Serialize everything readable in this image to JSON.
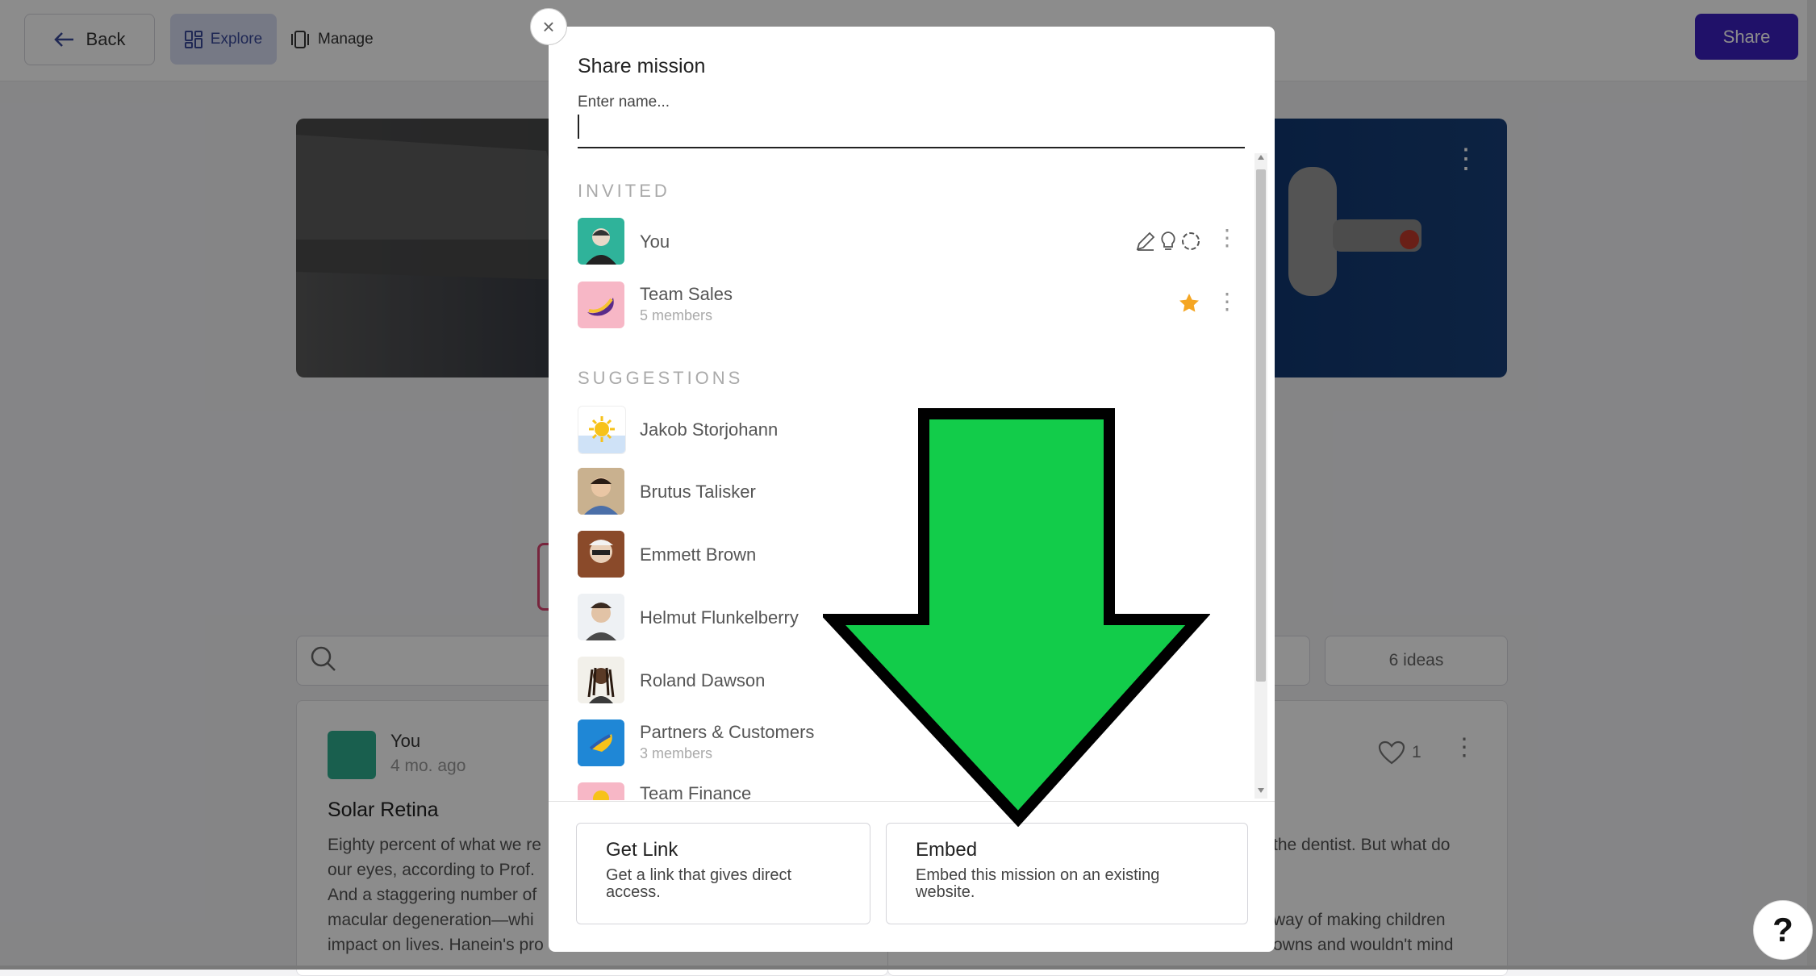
{
  "topbar": {
    "back_label": "Back",
    "explore_label": "Explore",
    "manage_label": "Manage",
    "share_label": "Share"
  },
  "board": {
    "ideas_count": "6 ideas",
    "card": {
      "author": "You",
      "date": "4 mo. ago",
      "title": "Solar Retina",
      "body_lines": [
        "Eighty percent of what we re",
        "our eyes, according to Prof.",
        "And a staggering number of",
        "macular degeneration—whi",
        "impact on lives. Hanein's pro"
      ]
    },
    "right_card": {
      "likes": "1",
      "body_line1": "the dentist. But what do",
      "body_line2": "way of making children",
      "body_line3": "owns and wouldn't mind"
    }
  },
  "modal": {
    "title": "Share mission",
    "input_label": "Enter name...",
    "invited_heading": "INVITED",
    "invited": [
      {
        "name": "You",
        "sub": ""
      },
      {
        "name": "Team Sales",
        "sub": "5 members"
      }
    ],
    "suggestions_heading": "SUGGESTIONS",
    "suggestions": [
      {
        "name": "Jakob Storjohann",
        "sub": ""
      },
      {
        "name": "Brutus Talisker",
        "sub": ""
      },
      {
        "name": "Emmett Brown",
        "sub": ""
      },
      {
        "name": "Helmut Flunkelberry",
        "sub": ""
      },
      {
        "name": "Roland Dawson",
        "sub": ""
      },
      {
        "name": "Partners & Customers",
        "sub": "3 members"
      },
      {
        "name": "Team Finance",
        "sub": ""
      }
    ],
    "get_link": {
      "title": "Get Link",
      "desc": "Get a link that gives direct access."
    },
    "embed": {
      "title": "Embed",
      "desc": "Embed this mission on an existing website."
    },
    "close_label": "×"
  },
  "help_label": "?",
  "colors": {
    "accent": "#3b1fbf",
    "arrow": "#12cc4a",
    "star": "#f5a623"
  }
}
